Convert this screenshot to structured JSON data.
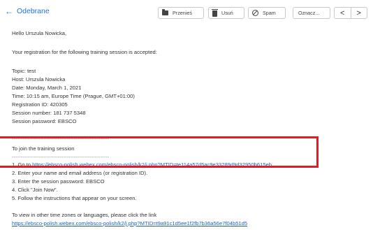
{
  "toolbar": {
    "back_label": "Odebrane",
    "move_label": "Przenieś",
    "delete_label": "Usuń",
    "spam_label": "Spam",
    "mark_label": "Oznacz...",
    "prev_glyph": "<",
    "next_glyph": ">"
  },
  "email": {
    "greeting": "Hello Urszula Nowicka,",
    "intro": "Your registration for the following training session is accepted:",
    "details": [
      "Topic: test",
      "Host: Urszula Nowicka",
      "Date: Monday, March 1, 2021",
      "Time: 10:15 am, Europe Time (Prague, GMT+01:00)",
      "Registration ID: 420305",
      "Session number: 181 737 5348",
      "Session password: EBSCO"
    ],
    "separator": "-------------------------------------------------------",
    "join_heading": "To join the training session",
    "step1_prefix": "1. Go to ",
    "step1_link": "https://ebsco-polish.webex.com/ebsco-polish/k2/j.php?MTID=te114a57d5ac9e33289d9d32950b615eb",
    "step2": "2. Enter your name and email address (or registration ID).",
    "step3": "3. Enter the session password: EBSCO",
    "step4": "4. Click \"Join Now\".",
    "step5": "5. Follow the instructions that appear on your screen.",
    "timezones_text": "To view in other time zones or languages, please click the link",
    "timezones_link": "https://ebsco-polish.webex.com/ebsco-polish/k2/j.php?MTID=t9a91c1d5ee1f2fb7b36a56e7f04b51d5"
  },
  "colors": {
    "link": "#1f5fbf",
    "back": "#1a73e8",
    "highlight_border": "#e31b23"
  }
}
